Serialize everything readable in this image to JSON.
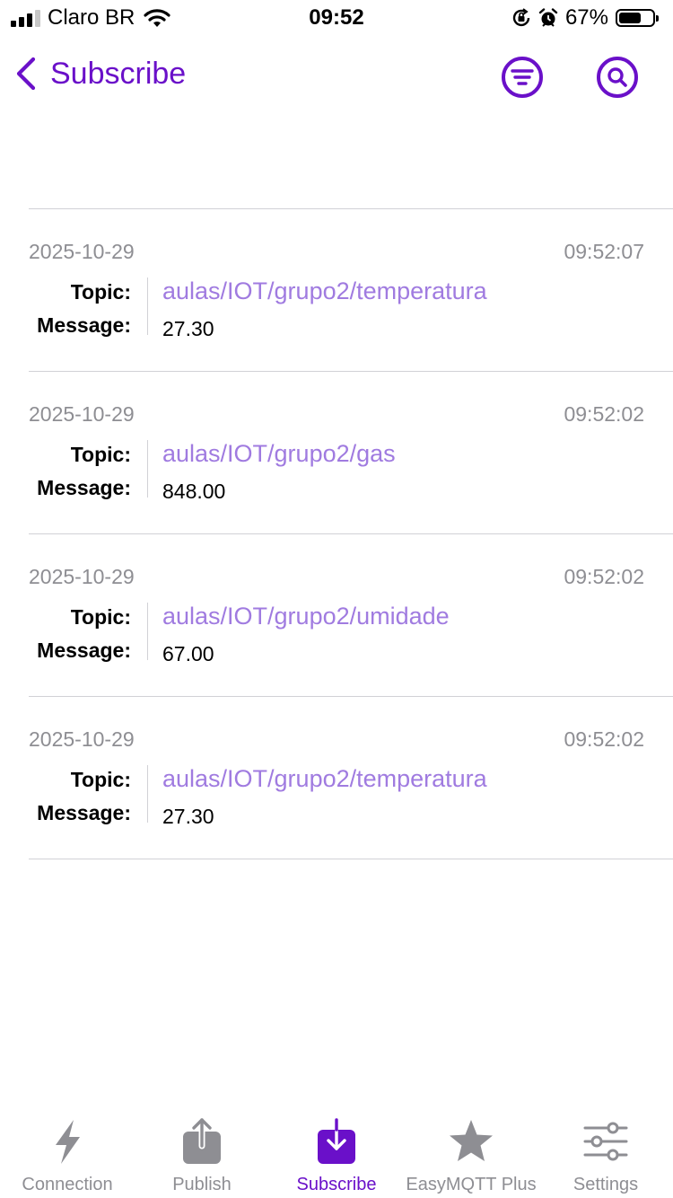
{
  "status_bar": {
    "carrier": "Claro BR",
    "time": "09:52",
    "battery": "67%",
    "battery_level": 0.67
  },
  "nav": {
    "back_label": "Subscribe",
    "filter_icon": "filter-icon",
    "search_icon": "search-icon",
    "accent_color": "#6a10c9"
  },
  "messages": [
    {
      "date": "2025-10-29",
      "time": "09:52:07",
      "topic_label": "Topic:",
      "message_label": "Message:",
      "topic": "aulas/IOT/grupo2/temperatura",
      "payload": "27.30"
    },
    {
      "date": "2025-10-29",
      "time": "09:52:02",
      "topic_label": "Topic:",
      "message_label": "Message:",
      "topic": "aulas/IOT/grupo2/gas",
      "payload": "848.00"
    },
    {
      "date": "2025-10-29",
      "time": "09:52:02",
      "topic_label": "Topic:",
      "message_label": "Message:",
      "topic": "aulas/IOT/grupo2/umidade",
      "payload": "67.00"
    },
    {
      "date": "2025-10-29",
      "time": "09:52:02",
      "topic_label": "Topic:",
      "message_label": "Message:",
      "topic": "aulas/IOT/grupo2/temperatura",
      "payload": "27.30"
    }
  ],
  "tabs": [
    {
      "label": "Connection",
      "icon": "bolt-icon",
      "active": false
    },
    {
      "label": "Publish",
      "icon": "upload-icon",
      "active": false
    },
    {
      "label": "Subscribe",
      "icon": "download-icon",
      "active": true
    },
    {
      "label": "EasyMQTT Plus",
      "icon": "star-icon",
      "active": false
    },
    {
      "label": "Settings",
      "icon": "sliders-icon",
      "active": false
    }
  ]
}
